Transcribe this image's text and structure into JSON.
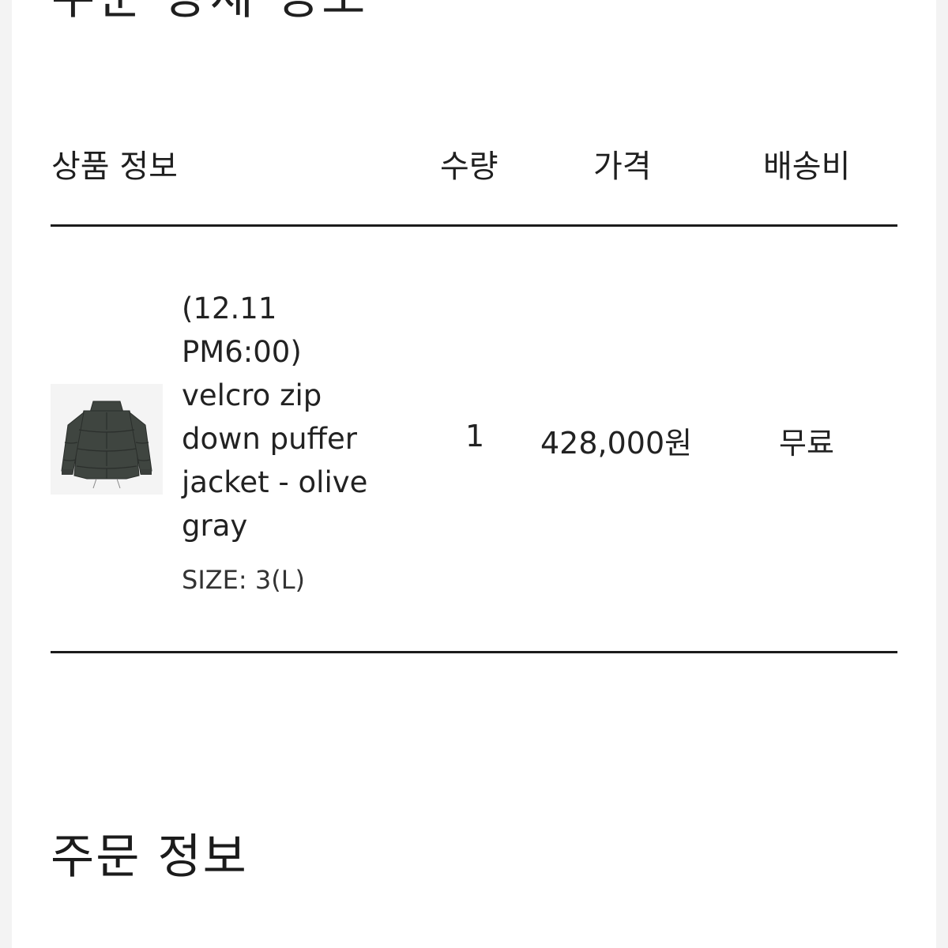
{
  "page": {
    "title": "주문 상세 정보"
  },
  "table": {
    "headers": {
      "product": "상품 정보",
      "quantity": "수량",
      "price": "가격",
      "shipping": "배송비"
    },
    "rows": [
      {
        "name": "(12.11 PM6:00) velcro zip down puffer jacket - olive gray",
        "option": "SIZE: 3(L)",
        "quantity": "1",
        "price": "428,000원",
        "shipping": "무료",
        "image_icon": "puffer-jacket-image",
        "jacket_color": "#3f4540"
      }
    ]
  },
  "order_section": {
    "title": "주문 정보"
  }
}
